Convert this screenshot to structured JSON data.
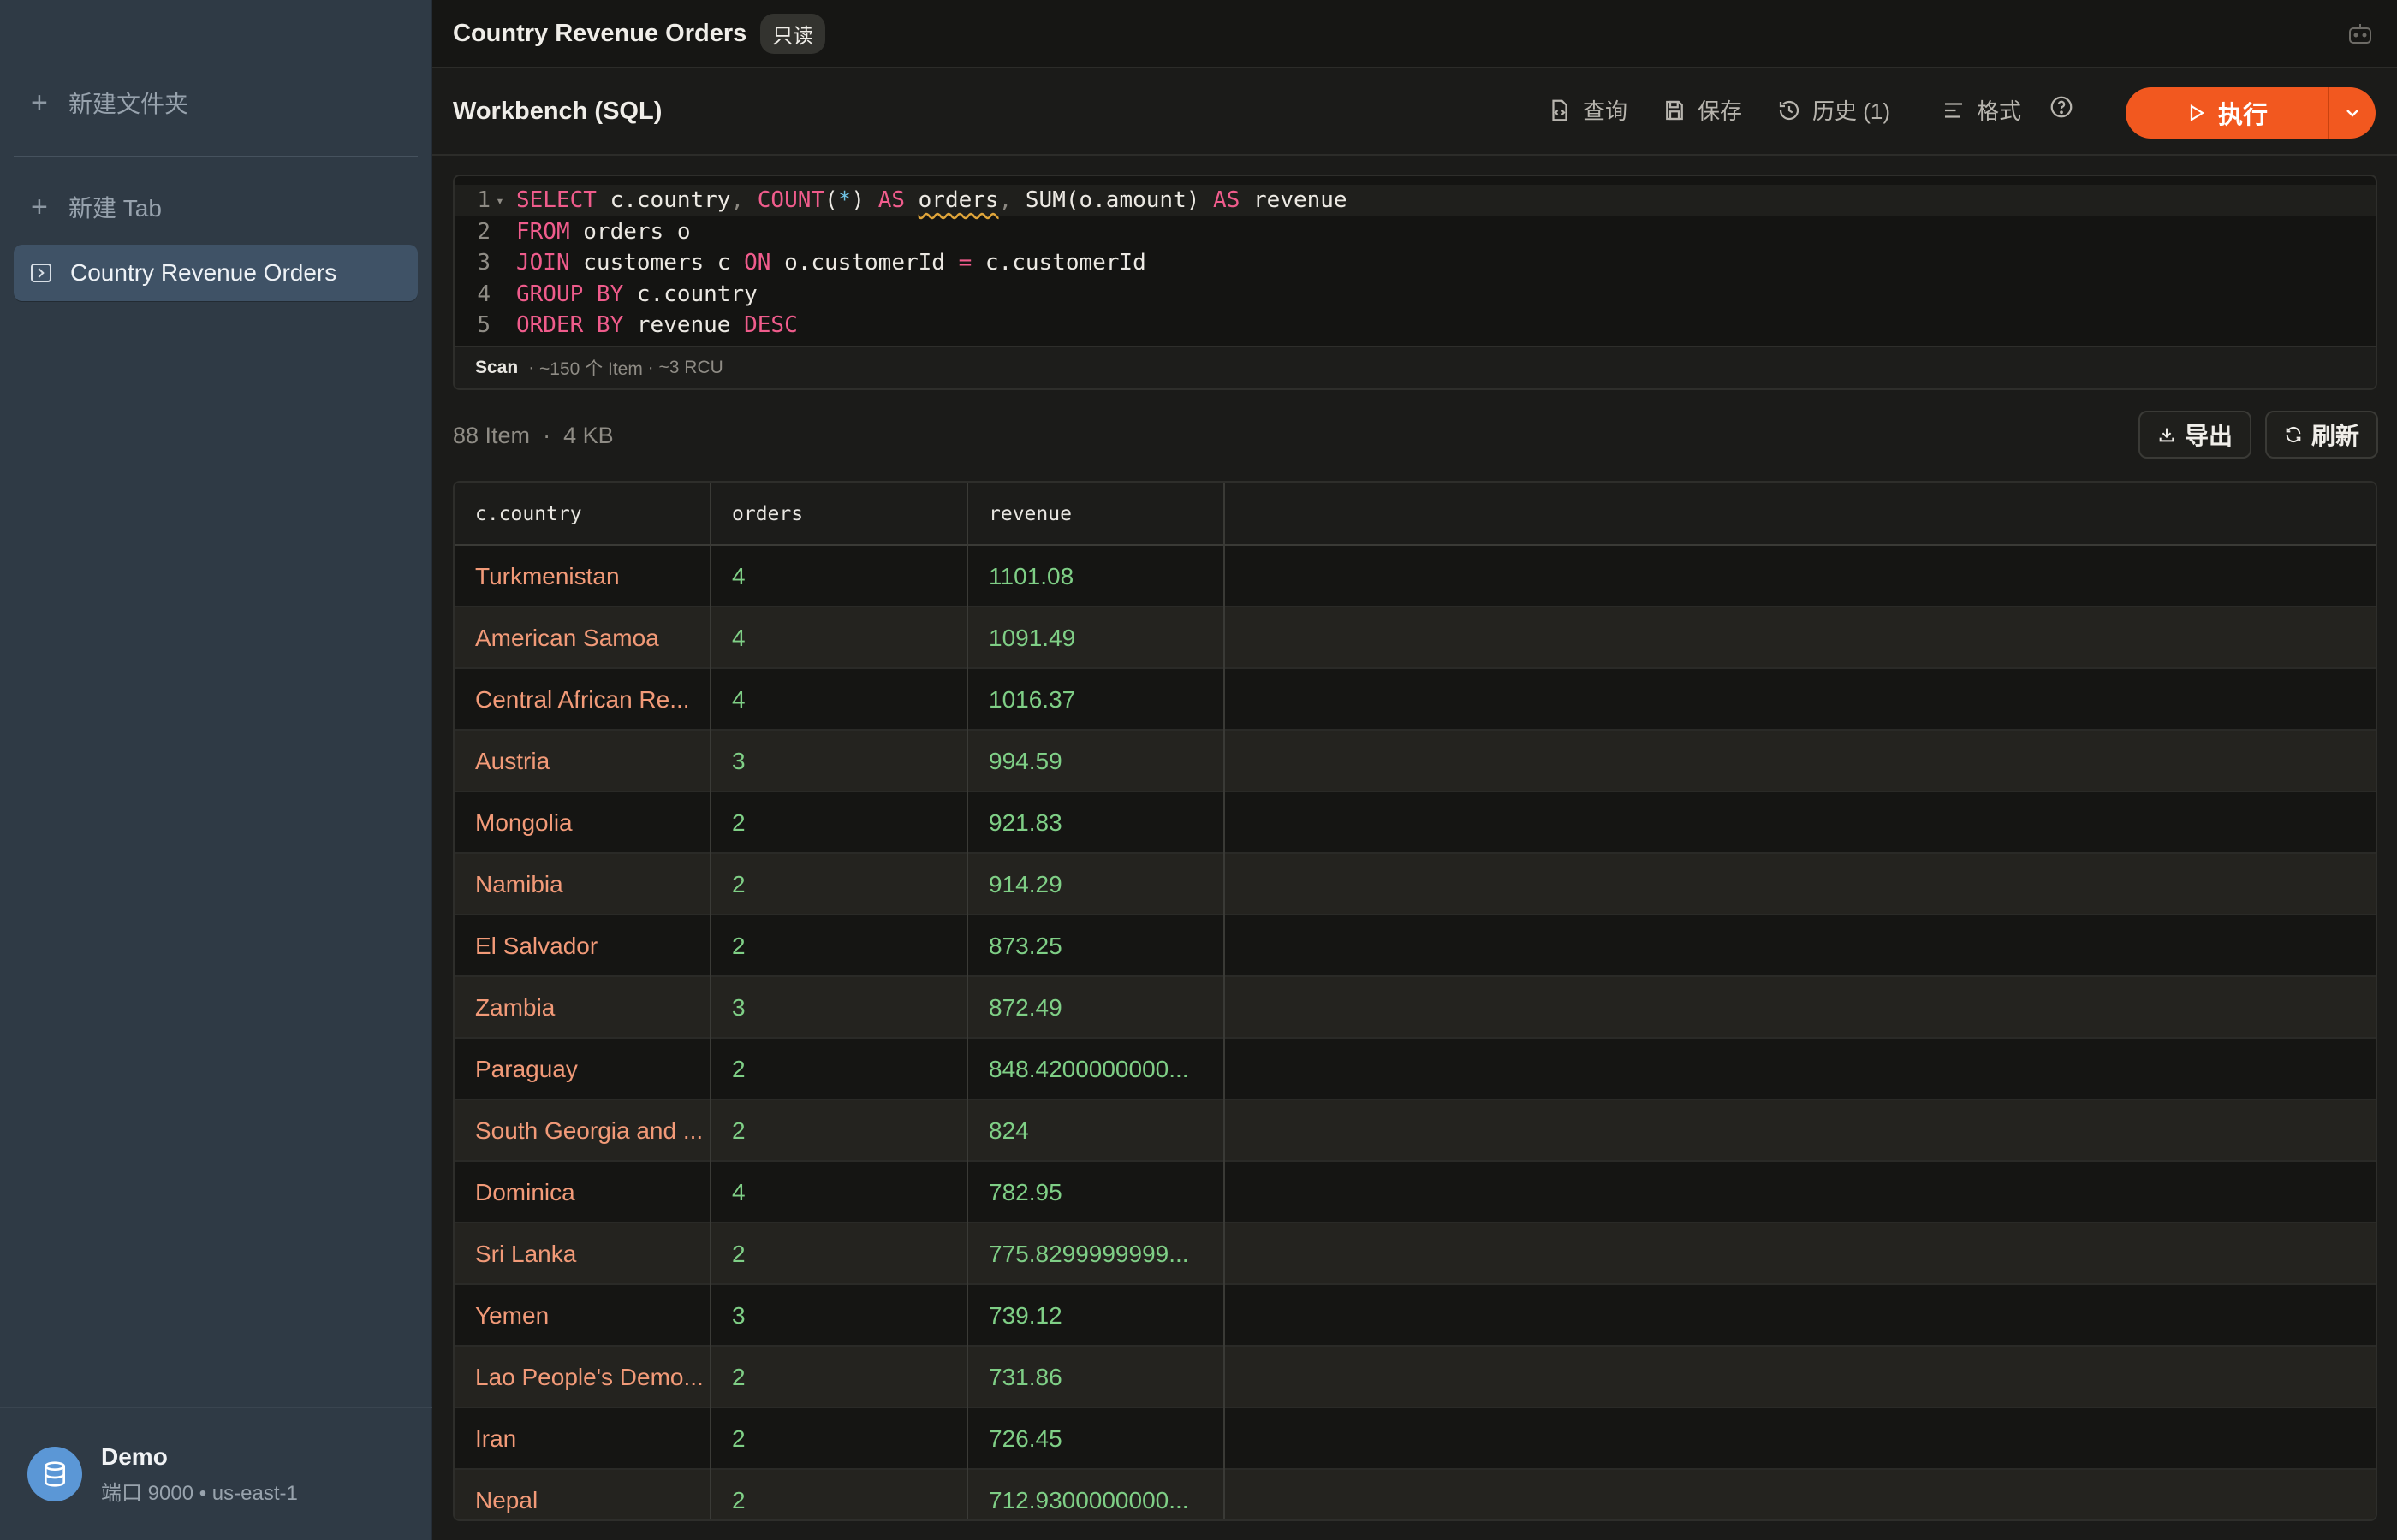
{
  "sidebar": {
    "new_folder": "新建文件夹",
    "new_tab": "新建 Tab",
    "tabs": [
      {
        "label": "Country Revenue Orders"
      }
    ],
    "connection": {
      "name": "Demo",
      "detail": "端口 9000 • us-east-1"
    }
  },
  "topbar": {
    "title": "Country Revenue Orders",
    "badge": "只读"
  },
  "toolbar": {
    "title": "Workbench (SQL)",
    "query": "查询",
    "save": "保存",
    "history": "历史 (1)",
    "format": "格式",
    "run": "执行"
  },
  "editor": {
    "lines": [
      "SELECT c.country, COUNT(*) AS orders, SUM(o.amount) AS revenue",
      "FROM orders o",
      "JOIN customers c ON o.customerId = c.customerId",
      "GROUP BY c.country",
      "ORDER BY revenue DESC"
    ],
    "status": {
      "scan": "Scan",
      "items": "~150 个 Item",
      "rcu": "~3 RCU"
    }
  },
  "results": {
    "count": "88 Item",
    "size": "4 KB",
    "export": "导出",
    "refresh": "刷新",
    "columns": [
      "c.country",
      "orders",
      "revenue"
    ],
    "rows": [
      [
        "Turkmenistan",
        "4",
        "1101.08"
      ],
      [
        "American Samoa",
        "4",
        "1091.49"
      ],
      [
        "Central African Re...",
        "4",
        "1016.37"
      ],
      [
        "Austria",
        "3",
        "994.59"
      ],
      [
        "Mongolia",
        "2",
        "921.83"
      ],
      [
        "Namibia",
        "2",
        "914.29"
      ],
      [
        "El Salvador",
        "2",
        "873.25"
      ],
      [
        "Zambia",
        "3",
        "872.49"
      ],
      [
        "Paraguay",
        "2",
        "848.4200000000..."
      ],
      [
        "South Georgia and ...",
        "2",
        "824"
      ],
      [
        "Dominica",
        "4",
        "782.95"
      ],
      [
        "Sri Lanka",
        "2",
        "775.8299999999..."
      ],
      [
        "Yemen",
        "3",
        "739.12"
      ],
      [
        "Lao People's Demo...",
        "2",
        "731.86"
      ],
      [
        "Iran",
        "2",
        "726.45"
      ],
      [
        "Nepal",
        "2",
        "712.9300000000..."
      ]
    ]
  },
  "colors": {
    "accent": "#f2581f",
    "sidebar": "#2f3a45",
    "country_text": "#f29a78",
    "number_text": "#7fcf86"
  }
}
